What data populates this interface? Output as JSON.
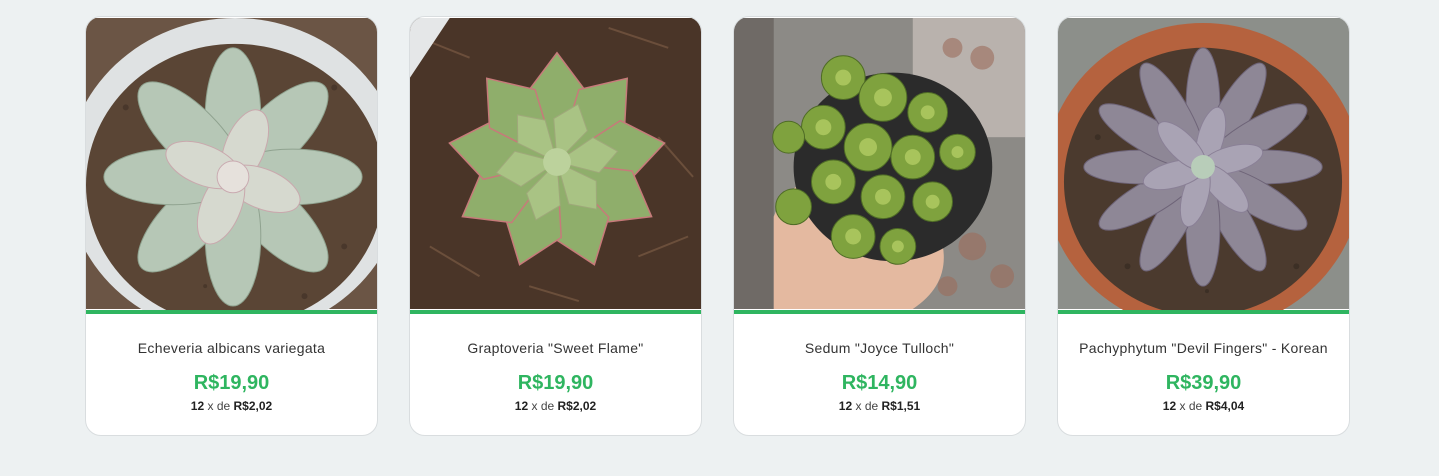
{
  "products": [
    {
      "name": "Echeveria albicans variegata",
      "price": "R$19,90",
      "installments_count": "12",
      "installments_joiner": "x de",
      "installment_value": "R$2,02",
      "image_icon": "echeveria-albicans-photo"
    },
    {
      "name": "Graptoveria \"Sweet Flame\"",
      "price": "R$19,90",
      "installments_count": "12",
      "installments_joiner": "x de",
      "installment_value": "R$2,02",
      "image_icon": "graptoveria-sweet-flame-photo"
    },
    {
      "name": "Sedum \"Joyce Tulloch\"",
      "price": "R$14,90",
      "installments_count": "12",
      "installments_joiner": "x de",
      "installment_value": "R$1,51",
      "image_icon": "sedum-joyce-tulloch-photo"
    },
    {
      "name": "Pachyphytum \"Devil Fingers\" - Korean",
      "price": "R$39,90",
      "installments_count": "12",
      "installments_joiner": "x de",
      "installment_value": "R$4,04",
      "image_icon": "pachyphytum-devil-fingers-photo"
    }
  ],
  "colors": {
    "accent": "#2fb560",
    "background": "#edf1f2"
  }
}
